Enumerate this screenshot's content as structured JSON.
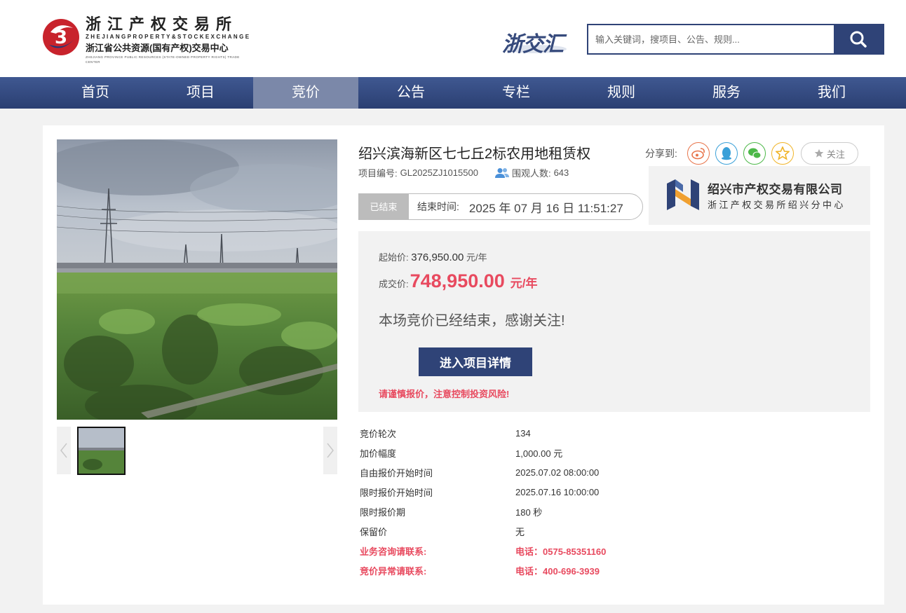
{
  "header": {
    "logo_cn": "浙江产权交易所",
    "logo_en": "ZHEJIANGPROPERTY&STOCKEXCHANGE",
    "logo_sub": "浙江省公共资源(国有产权)交易中心",
    "logo_sub_en": "ZHEJIANG PROVINCE PUBLIC RESOURCES (STATE-OWNED PROPERTY RIGHTS) TRADE CENTER",
    "zjh_logo": "浙交汇",
    "search_placeholder": "输入关键词，搜项目、公告、规则..."
  },
  "nav": [
    "首页",
    "项目",
    "竞价",
    "公告",
    "专栏",
    "规则",
    "服务",
    "我们"
  ],
  "nav_active_index": 2,
  "project": {
    "title": "绍兴滨海新区七七丘2标农用地租赁权",
    "code_label": "项目编号:",
    "code": "GL2025ZJ1015500",
    "viewers_label": "围观人数:",
    "viewers": "643",
    "status": "已结束",
    "end_label": "结束时间:",
    "end_time": "2025 年 07 月 16 日 11:51:27"
  },
  "share": {
    "label": "分享到:",
    "icons": [
      "weibo-icon",
      "qq-icon",
      "wechat-icon",
      "qzone-icon"
    ],
    "follow": "关注"
  },
  "org": {
    "name": "绍兴市产权交易有限公司",
    "sub": "浙江产权交易所绍兴分中心"
  },
  "price": {
    "start_label": "起始价:",
    "start_value": "376,950.00",
    "start_unit": "元/年",
    "deal_label": "成交价:",
    "deal_value": "748,950.00",
    "deal_unit": "元/年",
    "ended_msg": "本场竞价已经结束，感谢关注!",
    "detail_button": "进入项目详情",
    "risk_note": "请谨慎报价，注意控制投资风险!"
  },
  "info": [
    {
      "k": "竞价轮次",
      "v": "134"
    },
    {
      "k": "加价幅度",
      "v": "1,000.00 元"
    },
    {
      "k": "自由报价开始时间",
      "v": "2025.07.02 08:00:00"
    },
    {
      "k": "限时报价开始时间",
      "v": "2025.07.16 10:00:00"
    },
    {
      "k": "限时报价期",
      "v": "180 秒"
    },
    {
      "k": "保留价",
      "v": "无"
    },
    {
      "k": "业务咨询请联系:",
      "v": "电话：0575-85351160"
    },
    {
      "k": "竞价异常请联系:",
      "v": "电话：400-696-3939"
    }
  ],
  "colors": {
    "navy": "#2f4377",
    "accent_red": "#e84a5f",
    "nav_active": "#7b88a9"
  }
}
